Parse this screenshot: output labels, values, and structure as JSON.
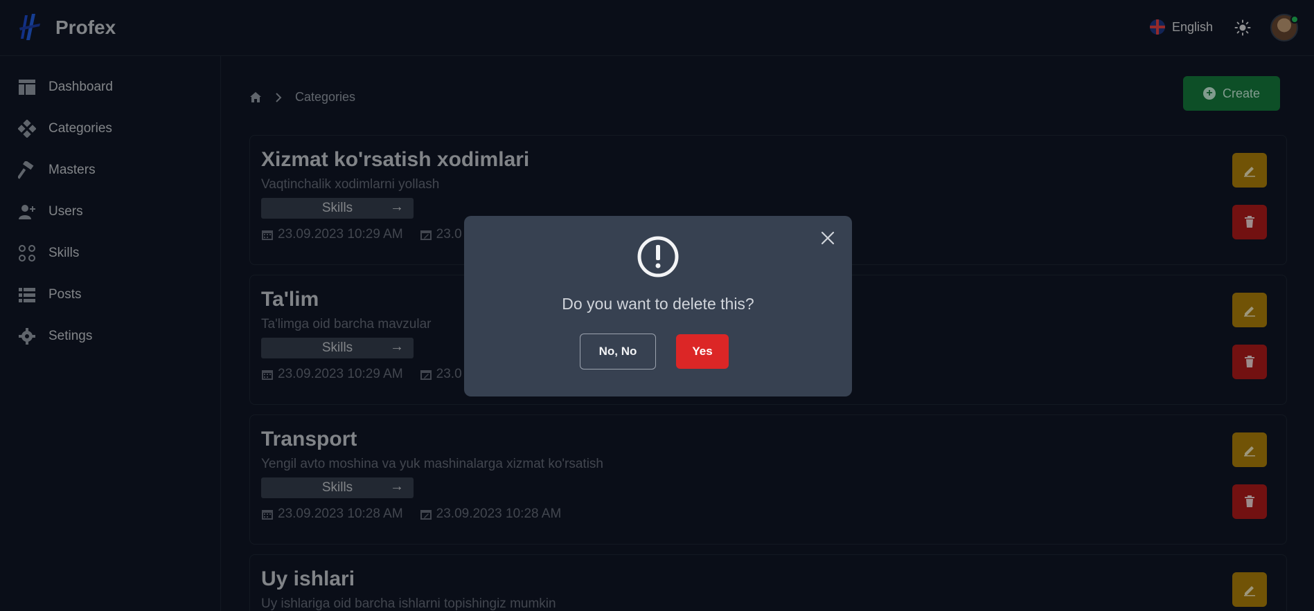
{
  "header": {
    "brand": "Profex",
    "language": "English",
    "icons": {
      "logo": "profex-logo-icon",
      "flag": "uk-flag-icon",
      "theme": "sun-icon",
      "avatar": "user-avatar"
    }
  },
  "sidebar": {
    "items": [
      {
        "label": "Dashboard",
        "icon": "dashboard-icon"
      },
      {
        "label": "Categories",
        "icon": "categories-icon"
      },
      {
        "label": "Masters",
        "icon": "hammer-icon"
      },
      {
        "label": "Users",
        "icon": "user-plus-icon"
      },
      {
        "label": "Skills",
        "icon": "skills-grid-icon"
      },
      {
        "label": "Posts",
        "icon": "list-icon"
      },
      {
        "label": "Setings",
        "icon": "gear-icon"
      }
    ]
  },
  "breadcrumb": {
    "home_icon": "home-icon",
    "separator_icon": "chevron-right-icon",
    "current": "Categories"
  },
  "create_button": {
    "label": "Create",
    "icon": "plus-circle-icon"
  },
  "categories": [
    {
      "title": "Xizmat ko'rsatish xodimlari",
      "description": "Vaqtinchalik xodimlarni yollash",
      "skills_label": "Skills",
      "created": "23.09.2023 10:29 AM",
      "updated": "23.0"
    },
    {
      "title": "Ta'lim",
      "description": "Ta'limga oid barcha mavzular",
      "skills_label": "Skills",
      "created": "23.09.2023 10:29 AM",
      "updated": "23.0"
    },
    {
      "title": "Transport",
      "description": "Yengil avto moshina va yuk mashinalarga xizmat ko'rsatish",
      "skills_label": "Skills",
      "created": "23.09.2023 10:28 AM",
      "updated": "23.09.2023 10:28 AM"
    },
    {
      "title": "Uy ishlari",
      "description": "Uy ishlariga oid barcha ishlarni topishingiz mumkin",
      "skills_label": "",
      "created": "",
      "updated": ""
    }
  ],
  "modal": {
    "message": "Do you want to delete this?",
    "no_label": "No, No",
    "yes_label": "Yes",
    "icon": "exclamation-circle-icon",
    "close_icon": "close-icon"
  },
  "colors": {
    "background": "#111827",
    "create": "#16803f",
    "edit": "#b7860b",
    "delete": "#b91c1c",
    "yes": "#dc2626",
    "modal": "#374151"
  }
}
